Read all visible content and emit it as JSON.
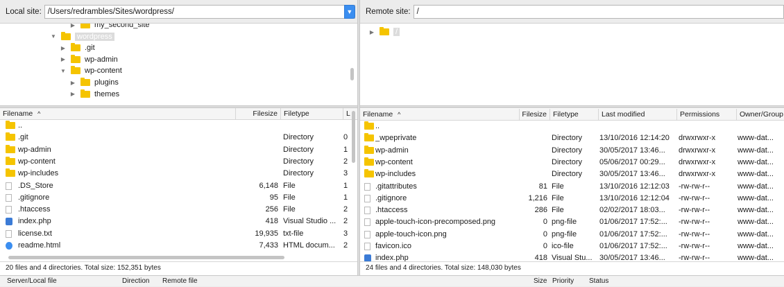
{
  "local": {
    "site_label": "Local site:",
    "path": "/Users/redrambles/Sites/wordpress/",
    "tree": [
      {
        "label": "my_second_site",
        "indent": 100,
        "open": false,
        "selected": false
      },
      {
        "label": "wordpress",
        "indent": 72,
        "open": true,
        "selected": true
      },
      {
        "label": ".git",
        "indent": 86,
        "open": false,
        "selected": false
      },
      {
        "label": "wp-admin",
        "indent": 86,
        "open": false,
        "selected": false
      },
      {
        "label": "wp-content",
        "indent": 86,
        "open": true,
        "selected": false
      },
      {
        "label": "plugins",
        "indent": 100,
        "open": false,
        "selected": false
      },
      {
        "label": "themes",
        "indent": 100,
        "open": false,
        "selected": false
      }
    ],
    "columns": {
      "filename": "Filename",
      "sort_arrow": "^",
      "filesize": "Filesize",
      "filetype": "Filetype",
      "last": "L"
    },
    "files": [
      {
        "icon": "folder",
        "name": "..",
        "size": "",
        "type": "",
        "extra": ""
      },
      {
        "icon": "folder",
        "name": ".git",
        "size": "",
        "type": "Directory",
        "extra": "0"
      },
      {
        "icon": "folder",
        "name": "wp-admin",
        "size": "",
        "type": "Directory",
        "extra": "1"
      },
      {
        "icon": "folder",
        "name": "wp-content",
        "size": "",
        "type": "Directory",
        "extra": "2"
      },
      {
        "icon": "folder",
        "name": "wp-includes",
        "size": "",
        "type": "Directory",
        "extra": "3"
      },
      {
        "icon": "file",
        "name": ".DS_Store",
        "size": "6,148",
        "type": "File",
        "extra": "1"
      },
      {
        "icon": "file",
        "name": ".gitignore",
        "size": "95",
        "type": "File",
        "extra": "1"
      },
      {
        "icon": "file",
        "name": ".htaccess",
        "size": "256",
        "type": "File",
        "extra": "2"
      },
      {
        "icon": "vs",
        "name": "index.php",
        "size": "418",
        "type": "Visual Studio ...",
        "extra": "2"
      },
      {
        "icon": "file",
        "name": "license.txt",
        "size": "19,935",
        "type": "txt-file",
        "extra": "3"
      },
      {
        "icon": "html",
        "name": "readme.html",
        "size": "7,433",
        "type": "HTML docum...",
        "extra": "2"
      }
    ],
    "status": "20 files and 4 directories. Total size: 152,351 bytes"
  },
  "remote": {
    "site_label": "Remote site:",
    "path": "/",
    "tree_root": "/",
    "columns": {
      "filename": "Filename",
      "sort_arrow": "^",
      "filesize": "Filesize",
      "filetype": "Filetype",
      "modified": "Last modified",
      "permissions": "Permissions",
      "owner": "Owner/Group"
    },
    "files": [
      {
        "icon": "folder",
        "name": "..",
        "size": "",
        "type": "",
        "modified": "",
        "perm": "",
        "owner": ""
      },
      {
        "icon": "folder",
        "name": "_wpeprivate",
        "size": "",
        "type": "Directory",
        "modified": "13/10/2016 12:14:20",
        "perm": "drwxrwxr-x",
        "owner": "www-dat..."
      },
      {
        "icon": "folder",
        "name": "wp-admin",
        "size": "",
        "type": "Directory",
        "modified": "30/05/2017 13:46...",
        "perm": "drwxrwxr-x",
        "owner": "www-dat..."
      },
      {
        "icon": "folder",
        "name": "wp-content",
        "size": "",
        "type": "Directory",
        "modified": "05/06/2017 00:29...",
        "perm": "drwxrwxr-x",
        "owner": "www-dat..."
      },
      {
        "icon": "folder",
        "name": "wp-includes",
        "size": "",
        "type": "Directory",
        "modified": "30/05/2017 13:46...",
        "perm": "drwxrwxr-x",
        "owner": "www-dat..."
      },
      {
        "icon": "file",
        "name": ".gitattributes",
        "size": "81",
        "type": "File",
        "modified": "13/10/2016 12:12:03",
        "perm": "-rw-rw-r--",
        "owner": "www-dat..."
      },
      {
        "icon": "file",
        "name": ".gitignore",
        "size": "1,216",
        "type": "File",
        "modified": "13/10/2016 12:12:04",
        "perm": "-rw-rw-r--",
        "owner": "www-dat..."
      },
      {
        "icon": "file",
        "name": ".htaccess",
        "size": "286",
        "type": "File",
        "modified": "02/02/2017 18:03...",
        "perm": "-rw-rw-r--",
        "owner": "www-dat..."
      },
      {
        "icon": "file",
        "name": "apple-touch-icon-precomposed.png",
        "size": "0",
        "type": "png-file",
        "modified": "01/06/2017 17:52:...",
        "perm": "-rw-rw-r--",
        "owner": "www-dat..."
      },
      {
        "icon": "file",
        "name": "apple-touch-icon.png",
        "size": "0",
        "type": "png-file",
        "modified": "01/06/2017 17:52:...",
        "perm": "-rw-rw-r--",
        "owner": "www-dat..."
      },
      {
        "icon": "file",
        "name": "favicon.ico",
        "size": "0",
        "type": "ico-file",
        "modified": "01/06/2017 17:52:...",
        "perm": "-rw-rw-r--",
        "owner": "www-dat..."
      },
      {
        "icon": "vs",
        "name": "index.php",
        "size": "418",
        "type": "Visual Stu...",
        "modified": "30/05/2017 13:46...",
        "perm": "-rw-rw-r--",
        "owner": "www-dat..."
      }
    ],
    "status": "24 files and 4 directories. Total size: 148,030 bytes"
  },
  "queue": {
    "server_local_file": "Server/Local file",
    "direction": "Direction",
    "remote_file": "Remote file",
    "size": "Size",
    "priority": "Priority",
    "status": "Status"
  },
  "colors": {
    "folder": "#f5c400",
    "accent": "#3b8ef0"
  }
}
